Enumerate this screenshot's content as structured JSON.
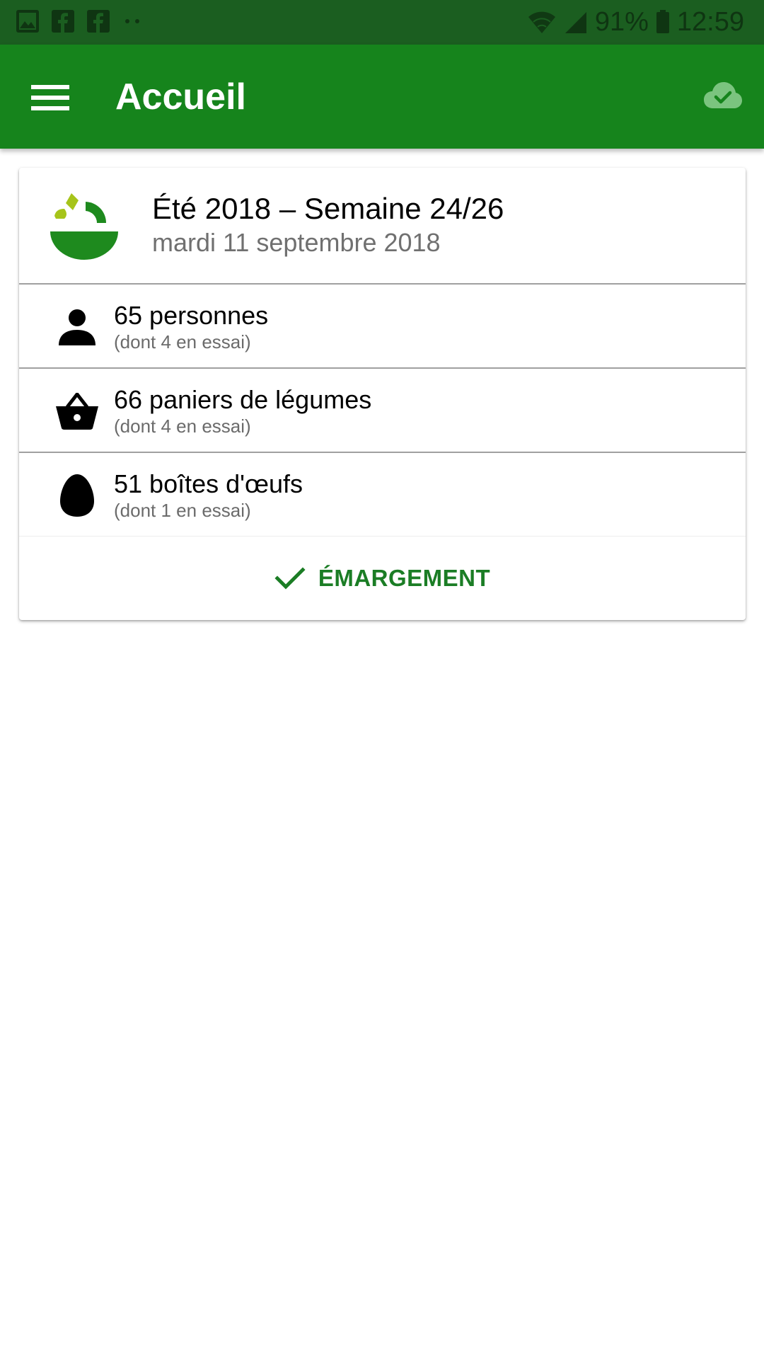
{
  "status_bar": {
    "icons_left": [
      "image-icon",
      "facebook-icon",
      "facebook-icon",
      "more-dots-icon"
    ],
    "icons_right": [
      "wifi-icon",
      "signal-icon",
      "battery-icon"
    ],
    "battery": "91%",
    "time": "12:59"
  },
  "app_bar": {
    "title": "Accueil",
    "menu_icon": "hamburger-menu-icon",
    "sync_icon": "cloud-done-icon"
  },
  "colors": {
    "status_bar": "#1b5e20",
    "app_bar": "#16841c",
    "accent": "#1b7d25",
    "logo_green": "#1e8a1e",
    "logo_leaf": "#a6c41a"
  },
  "card": {
    "title": "Été 2018 – Semaine 24/26",
    "date": "mardi 11 septembre 2018",
    "stats": [
      {
        "icon": "person-icon",
        "main": "65 personnes",
        "sub": "(dont 4 en essai)"
      },
      {
        "icon": "basket-icon",
        "main": "66 paniers de légumes",
        "sub": "(dont 4 en essai)"
      },
      {
        "icon": "egg-icon",
        "main": "51 boîtes d'œufs",
        "sub": "(dont 1 en essai)"
      }
    ],
    "action": {
      "icon": "check-icon",
      "label": "ÉMARGEMENT"
    }
  }
}
